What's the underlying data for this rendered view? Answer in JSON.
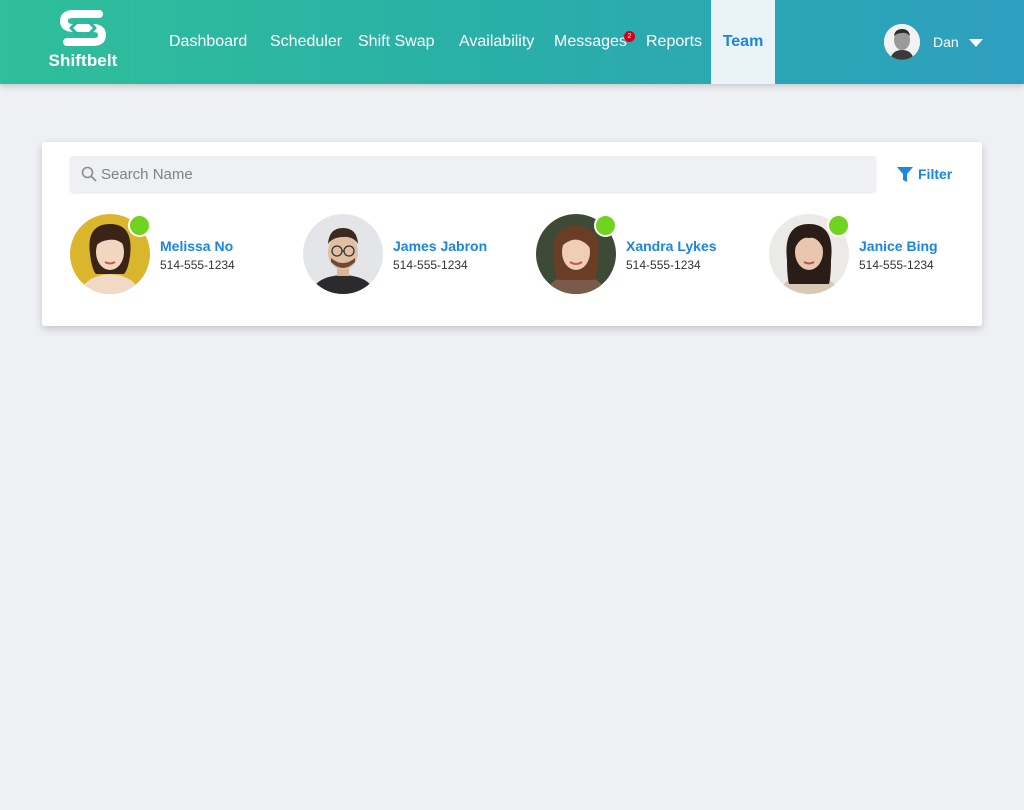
{
  "app": {
    "name": "Shiftbelt",
    "brand_color": "#2fbf9a",
    "accent_color": "#1a86e0",
    "logo_icon": "shiftbelt-s-arrows-icon"
  },
  "nav": {
    "items": [
      {
        "label": "Dashboard"
      },
      {
        "label": "Scheduler"
      },
      {
        "label": "Shift Swap"
      },
      {
        "label": "Availability"
      },
      {
        "label": "Messages",
        "badge": "2"
      },
      {
        "label": "Reports"
      },
      {
        "label": "Team",
        "active": true
      }
    ]
  },
  "user": {
    "name": "Dan",
    "menu_icon": "caret-down-icon"
  },
  "search": {
    "placeholder": "Search Name",
    "value": "",
    "icon": "search-icon"
  },
  "filter": {
    "label": "Filter",
    "icon": "filter-icon"
  },
  "team": {
    "online_color": "#6fd31f",
    "members": [
      {
        "name": "Melissa No",
        "phone": "514-555-1234",
        "online": true
      },
      {
        "name": "James Jabron",
        "phone": "514-555-1234",
        "online": false
      },
      {
        "name": "Xandra Lykes",
        "phone": "514-555-1234",
        "online": true
      },
      {
        "name": "Janice Bing",
        "phone": "514-555-1234",
        "online": true
      }
    ]
  }
}
